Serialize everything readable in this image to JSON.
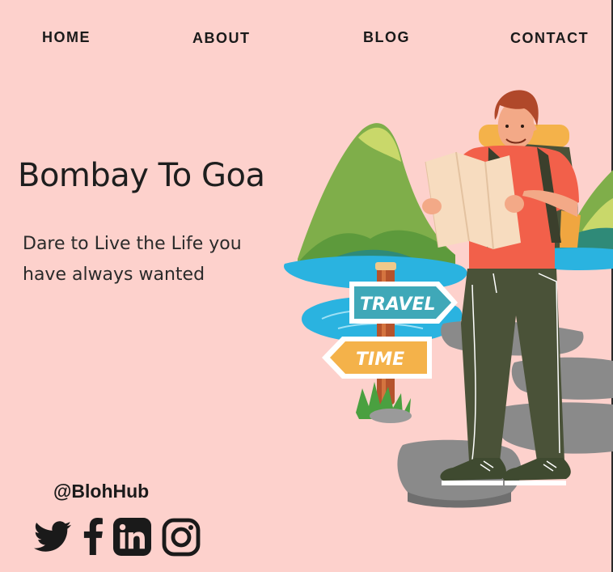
{
  "nav": {
    "home": "HOME",
    "about": "ABOUT",
    "blog": "BLOG",
    "contact": "CONTACT"
  },
  "hero": {
    "title": "Bombay To Goa",
    "subtitle": "Dare to Live the Life you have always wanted"
  },
  "signpost": {
    "top": "TRAVEL",
    "bottom": "TIME"
  },
  "social": {
    "handle": "@BlohHub",
    "icons": [
      "twitter-icon",
      "facebook-icon",
      "linkedin-icon",
      "instagram-icon"
    ]
  },
  "colors": {
    "background": "#fdd1cc",
    "text": "#1a1a1a",
    "shirt": "#f2604a",
    "pants": "#4a5238",
    "water": "#2ab3e0",
    "sign_teal": "#3fa8b8",
    "sign_orange": "#f4b24a"
  }
}
